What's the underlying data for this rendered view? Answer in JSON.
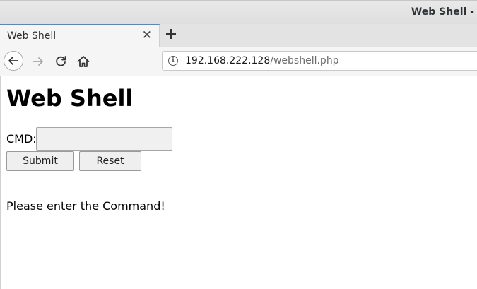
{
  "window": {
    "title": "Web Shell -"
  },
  "tabs": [
    {
      "label": "Web Shell"
    }
  ],
  "address_bar": {
    "host": "192.168.222.128",
    "path": "/webshell.php"
  },
  "icons": {
    "back": "back-arrow-icon",
    "forward": "forward-arrow-icon",
    "reload": "reload-icon",
    "home": "home-icon",
    "info": "info-icon",
    "close": "close-icon",
    "new_tab": "plus-icon"
  },
  "page": {
    "heading": "Web Shell",
    "cmd_label": "CMD:",
    "cmd_value": "",
    "submit_label": "Submit",
    "reset_label": "Reset",
    "message": "Please enter the Command!"
  },
  "colors": {
    "tab_accent": "#3d8ee0"
  }
}
